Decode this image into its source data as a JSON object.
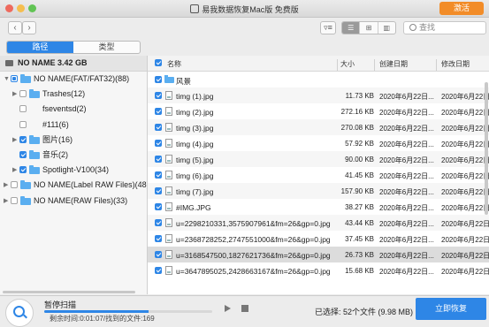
{
  "window": {
    "title": "易我数据恢复Mac版 免费版"
  },
  "header": {
    "activate_label": "激活"
  },
  "toolbar": {
    "back_glyph": "‹",
    "forward_glyph": "›",
    "search_placeholder": "查找"
  },
  "tabs": [
    {
      "label": "路径",
      "active": true
    },
    {
      "label": "类型",
      "active": false
    }
  ],
  "sidebar": {
    "drive_label": "NO NAME 3.42 GB",
    "tree": [
      {
        "label": "NO NAME(FAT/FAT32)(88)",
        "level": 0,
        "expanded": true,
        "check": "partial",
        "folder": true
      },
      {
        "label": "Trashes(12)",
        "level": 1,
        "expanded": false,
        "check": "none",
        "folder": true
      },
      {
        "label": "fseventsd(2)",
        "level": 1,
        "expanded": null,
        "check": "none",
        "folder": false
      },
      {
        "label": "#111(6)",
        "level": 1,
        "expanded": null,
        "check": "none",
        "folder": false
      },
      {
        "label": "图片(16)",
        "level": 1,
        "expanded": false,
        "check": "checked",
        "folder": true
      },
      {
        "label": "音乐(2)",
        "level": 1,
        "expanded": null,
        "check": "checked",
        "folder": true
      },
      {
        "label": "Spotlight-V100(34)",
        "level": 1,
        "expanded": false,
        "check": "checked",
        "folder": true
      },
      {
        "label": "NO NAME(Label RAW Files)(48)",
        "level": 0,
        "expanded": false,
        "check": "none",
        "folder": true
      },
      {
        "label": "NO NAME(RAW Files)(33)",
        "level": 0,
        "expanded": false,
        "check": "none",
        "folder": true
      }
    ]
  },
  "table": {
    "columns": {
      "name": "名称",
      "size": "大小",
      "created": "创建日期",
      "modified": "修改日期"
    },
    "rows": [
      {
        "name": "风景",
        "size": "",
        "created": "",
        "modified": "",
        "type": "folder",
        "checked": true,
        "selected": false
      },
      {
        "name": "timg (1).jpg",
        "size": "11.73 KB",
        "created": "2020年6月22日...",
        "modified": "2020年6月22日",
        "type": "file",
        "checked": true,
        "selected": false
      },
      {
        "name": "timg (2).jpg",
        "size": "272.16 KB",
        "created": "2020年6月22日...",
        "modified": "2020年6月22日",
        "type": "file",
        "checked": true,
        "selected": false
      },
      {
        "name": "timg (3).jpg",
        "size": "270.08 KB",
        "created": "2020年6月22日...",
        "modified": "2020年6月22日",
        "type": "file",
        "checked": true,
        "selected": false
      },
      {
        "name": "timg (4).jpg",
        "size": "57.92 KB",
        "created": "2020年6月22日...",
        "modified": "2020年6月22日",
        "type": "file",
        "checked": true,
        "selected": false
      },
      {
        "name": "timg (5).jpg",
        "size": "90.00 KB",
        "created": "2020年6月22日...",
        "modified": "2020年6月22日",
        "type": "file",
        "checked": true,
        "selected": false
      },
      {
        "name": "timg (6).jpg",
        "size": "41.45 KB",
        "created": "2020年6月22日...",
        "modified": "2020年6月22日",
        "type": "file",
        "checked": true,
        "selected": false
      },
      {
        "name": "timg (7).jpg",
        "size": "157.90 KB",
        "created": "2020年6月22日...",
        "modified": "2020年6月22日",
        "type": "file",
        "checked": true,
        "selected": false
      },
      {
        "name": "#IMG.JPG",
        "size": "38.27 KB",
        "created": "2020年6月22日...",
        "modified": "2020年6月22日",
        "type": "file",
        "checked": true,
        "selected": false
      },
      {
        "name": "u=2298210331,3575907961&fm=26&gp=0.jpg",
        "size": "43.44 KB",
        "created": "2020年6月22日...",
        "modified": "2020年6月22日",
        "type": "file",
        "checked": true,
        "selected": false
      },
      {
        "name": "u=2368728252,2747551000&fm=26&gp=0.jpg",
        "size": "37.45 KB",
        "created": "2020年6月22日...",
        "modified": "2020年6月22日",
        "type": "file",
        "checked": true,
        "selected": false
      },
      {
        "name": "u=3168547500,1827621736&fm=26&gp=0.jpg",
        "size": "26.73 KB",
        "created": "2020年6月22日...",
        "modified": "2020年6月22日",
        "type": "file",
        "checked": true,
        "selected": true
      },
      {
        "name": "u=3647895025,2428663167&fm=26&gp=0.jpg",
        "size": "15.68 KB",
        "created": "2020年6月22日...",
        "modified": "2020年6月22日",
        "type": "file",
        "checked": true,
        "selected": false
      }
    ]
  },
  "footer": {
    "scan_title": "暂停扫描",
    "remaining": "剩余时间:0:01:07/找到的文件:169",
    "progress": 0.62,
    "selected_text": "已选择: 52个文件 (9.98 MB)",
    "recover_label": "立即恢复"
  },
  "colors": {
    "accent": "#2e86e6",
    "activate": "#f28c28",
    "folder": "#5aaef0"
  },
  "icons": [
    "lock-icon",
    "back-arrow-icon",
    "forward-arrow-icon",
    "filter-icon",
    "list-view-icon",
    "grid-view-icon",
    "column-view-icon",
    "search-icon",
    "drive-icon",
    "folder-icon",
    "file-icon",
    "scan-magnifier-icon",
    "play-icon",
    "stop-icon"
  ]
}
